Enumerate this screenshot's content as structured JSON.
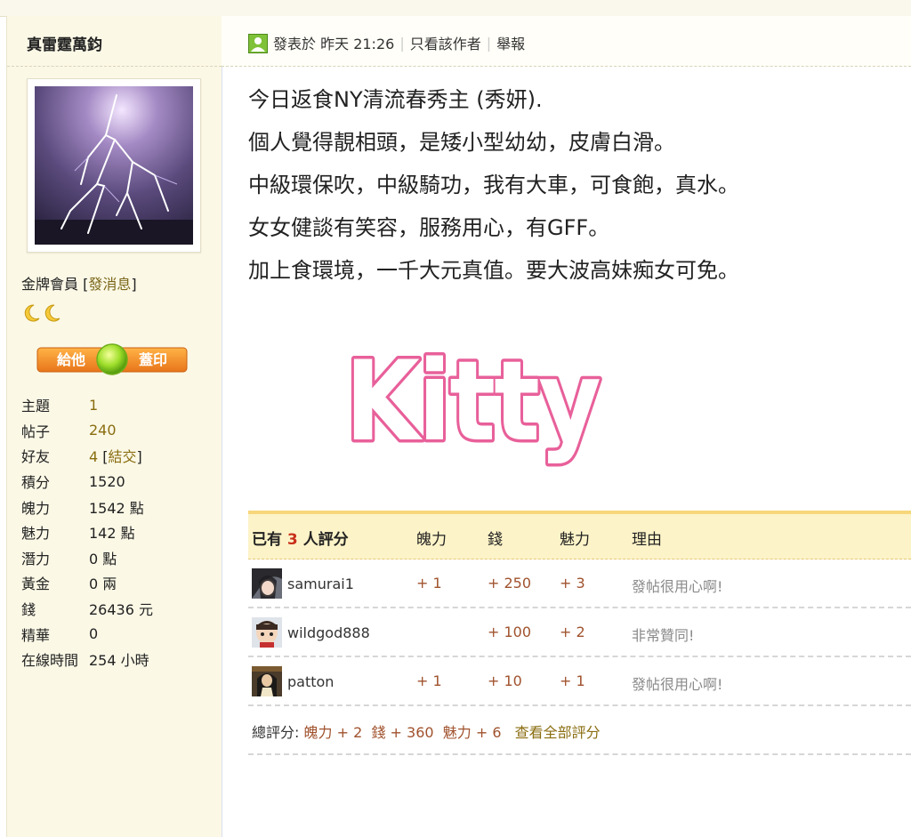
{
  "author": {
    "name": "真雷霆萬鈞",
    "rank": "金牌會員",
    "send_message": "發消息",
    "stamp_left": "給他",
    "stamp_right": "蓋印"
  },
  "stats": [
    {
      "label": "主題",
      "value": "1",
      "highlight": true
    },
    {
      "label": "帖子",
      "value": "240",
      "highlight": true
    },
    {
      "label": "好友",
      "value": "4",
      "highlight": true,
      "link": "結交"
    },
    {
      "label": "積分",
      "value": "1520"
    },
    {
      "label": "魄力",
      "value": "1542 點"
    },
    {
      "label": "魅力",
      "value": "142 點"
    },
    {
      "label": "潛力",
      "value": "0 點"
    },
    {
      "label": "黃金",
      "value": "0 兩"
    },
    {
      "label": "錢",
      "value": "26436 元"
    },
    {
      "label": "精華",
      "value": "0"
    },
    {
      "label": "在線時間",
      "value": "254 小時"
    }
  ],
  "post": {
    "posted_label": "發表於",
    "posted_time": "昨天 21:26",
    "only_author": "只看該作者",
    "report": "舉報",
    "lines": [
      "今日返食NY清流春秀主 (秀妍).",
      "個人覺得靚相頭，是矮小型幼幼，皮膚白滑。",
      "中級環保吹，中級騎功，我有大車，可食飽，真水。",
      "女女健談有笑容，服務用心，有GFF。",
      "加上食環境，一千大元真值。要大波高妹痴女可免。"
    ],
    "watermark": "Kitty"
  },
  "ratings": {
    "title_prefix": "已有",
    "count": "3",
    "title_suffix": "人評分",
    "columns": [
      "魄力",
      "錢",
      "魅力",
      "理由"
    ],
    "rows": [
      {
        "user": "samurai1",
        "po": "+ 1",
        "money": "+ 250",
        "charm": "+ 3",
        "reason": "發帖很用心啊!"
      },
      {
        "user": "wildgod888",
        "po": "",
        "money": "+ 100",
        "charm": "+ 2",
        "reason": "非常贊同!"
      },
      {
        "user": "patton",
        "po": "+ 1",
        "money": "+ 10",
        "charm": "+ 1",
        "reason": "發帖很用心啊!"
      }
    ],
    "total_label": "總評分:",
    "total_po": "魄力 + 2",
    "total_money": "錢 + 360",
    "total_charm": "魅力 + 6",
    "view_all": "查看全部評分"
  },
  "colors": {
    "sidebar_bg": "#fbf8e6",
    "gold_text": "#8a6d10",
    "rating_header_bg": "#fdf3c8",
    "watermark_pink": "#e8609a"
  }
}
